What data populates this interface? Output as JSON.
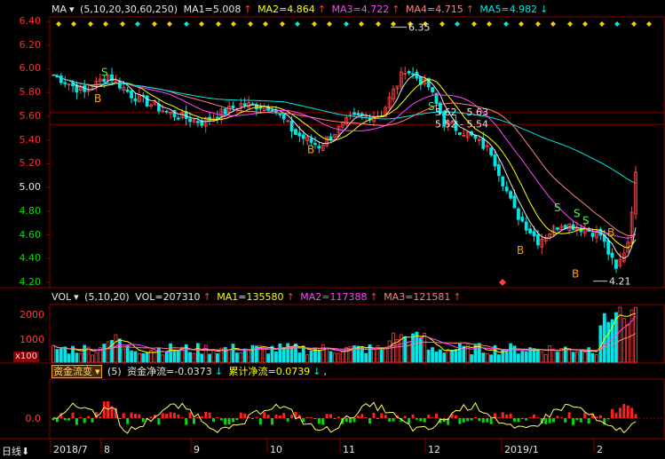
{
  "price_header": {
    "name": "MA",
    "params": "(5,10,20,30,60,250)",
    "items": [
      {
        "label": "MA1=5.008",
        "arrow": "↑",
        "color": "#e6e6e6"
      },
      {
        "label": "MA2=4.864",
        "arrow": "↑",
        "color": "#ffff00"
      },
      {
        "label": "MA3=4.722",
        "arrow": "↑",
        "color": "#ff44ff"
      },
      {
        "label": "MA4=4.715",
        "arrow": "↑",
        "color": "#ff8080"
      },
      {
        "label": "MA5=4.982",
        "arrow": "↓",
        "color": "#00e5e5"
      }
    ]
  },
  "price_axis": [
    "6.40",
    "6.20",
    "6.00",
    "5.80",
    "5.60",
    "5.40",
    "5.20",
    "5.00",
    "4.80",
    "4.60",
    "4.40",
    "4.20"
  ],
  "annotations": {
    "high": "6.35",
    "low": "4.21",
    "range1": "5.62 - 5.63",
    "range2": "5.52 - 5.54"
  },
  "signals": {
    "buy": "B",
    "sell": "S"
  },
  "vol_header": {
    "name": "VOL",
    "params": "(5,10,20)",
    "vol": "VOL=207310",
    "vol_arrow": "↑",
    "ma1": "MA1=135580",
    "ma1_arrow": "↑",
    "ma2": "MA2=117388",
    "ma2_arrow": "↑",
    "ma3": "MA3=121581",
    "ma3_arrow": "↑"
  },
  "vol_axis": [
    "2000",
    "1000"
  ],
  "vol_unit": "x100",
  "fund_header": {
    "name": "资金流变",
    "params": "(5)",
    "net": "资金净流=-0.0373",
    "net_arrow": "↓",
    "cum": "累计净流=0.0739",
    "cum_arrow": "↓"
  },
  "fund_axis": [
    "0.0"
  ],
  "timeline": {
    "period": "日线",
    "labels": [
      "2018/7",
      "8",
      "9",
      "10",
      "11",
      "12",
      "2019/1",
      "2"
    ]
  },
  "colors": {
    "up": "#ff4040",
    "down": "#00e5e5",
    "axis_red": "#ff3030",
    "axis_green": "#00e000",
    "border": "#8b0000"
  }
}
